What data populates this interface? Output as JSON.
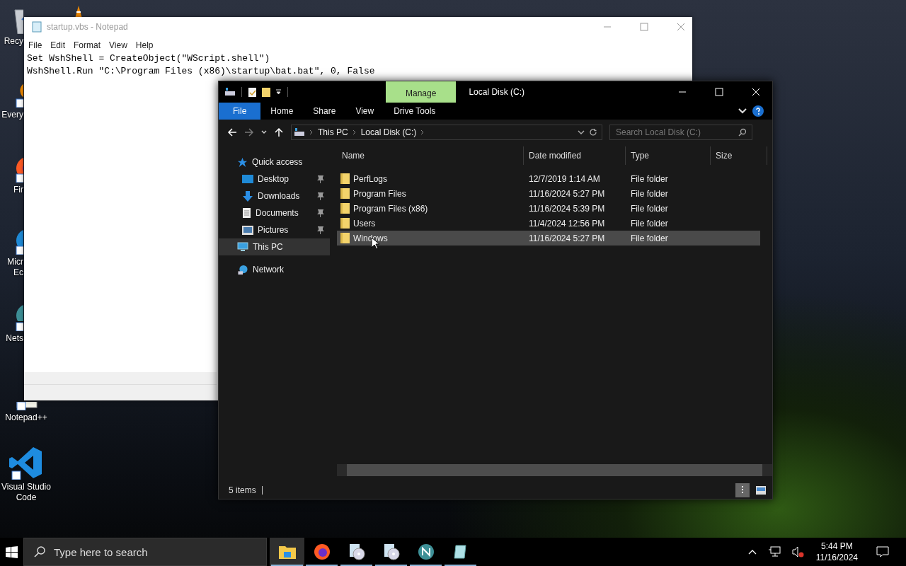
{
  "desktop_icons": [
    {
      "kind": "recycle-bin",
      "lines": [
        "Recy"
      ]
    },
    {
      "kind": "everything",
      "lines": [
        "Every"
      ]
    },
    {
      "kind": "firefox",
      "lines": [
        "Fir"
      ]
    },
    {
      "kind": "edge",
      "lines": [
        "Micr",
        "Ec"
      ]
    },
    {
      "kind": "netscape",
      "lines": [
        "Nets"
      ]
    },
    {
      "kind": "notepadpp",
      "lines": [
        "Notepad++"
      ]
    },
    {
      "kind": "vscode",
      "lines": [
        "Visual Studio",
        "Code"
      ]
    }
  ],
  "notepad": {
    "title": "startup.vbs - Notepad",
    "menu": [
      "File",
      "Edit",
      "Format",
      "View",
      "Help"
    ],
    "lines": [
      "Set WshShell = CreateObject(\"WScript.shell\")",
      "WshShell.Run \"C:\\Program Files (x86)\\startup\\bat.bat\", 0, False"
    ]
  },
  "explorer": {
    "context_tab": "Manage",
    "title": "Local Disk (C:)",
    "ribbon_tabs": [
      {
        "label": "File",
        "kind": "file"
      },
      {
        "label": "Home",
        "kind": "tab"
      },
      {
        "label": "Share",
        "kind": "tab"
      },
      {
        "label": "View",
        "kind": "tab"
      },
      {
        "label": "Drive Tools",
        "kind": "tab"
      }
    ],
    "breadcrumb": [
      "This PC",
      "Local Disk (C:)"
    ],
    "search": {
      "placeholder": "Search Local Disk (C:)"
    },
    "nav": [
      {
        "label": "Quick access",
        "kind": "star",
        "selected": false,
        "children": [
          {
            "label": "Desktop",
            "kind": "desktop",
            "pinned": true,
            "selected": false
          },
          {
            "label": "Downloads",
            "kind": "downloads",
            "pinned": true,
            "selected": false
          },
          {
            "label": "Documents",
            "kind": "documents",
            "pinned": true,
            "selected": false
          },
          {
            "label": "Pictures",
            "kind": "pictures",
            "pinned": true,
            "selected": false
          }
        ]
      },
      {
        "label": "This PC",
        "kind": "pc",
        "selected": true
      },
      {
        "label": "Network",
        "kind": "network",
        "selected": false
      }
    ],
    "columns": [
      "Name",
      "Date modified",
      "Type",
      "Size"
    ],
    "rows": [
      {
        "name": "PerfLogs",
        "date": "12/7/2019 1:14 AM",
        "type": "File folder",
        "selected": false
      },
      {
        "name": "Program Files",
        "date": "11/16/2024 5:27 PM",
        "type": "File folder",
        "selected": false
      },
      {
        "name": "Program Files (x86)",
        "date": "11/16/2024 5:39 PM",
        "type": "File folder",
        "selected": false
      },
      {
        "name": "Users",
        "date": "11/4/2024 12:56 PM",
        "type": "File folder",
        "selected": false
      },
      {
        "name": "Windows",
        "date": "11/16/2024 5:27 PM",
        "type": "File folder",
        "selected": true
      }
    ],
    "status": "5 items"
  },
  "taskbar": {
    "search_placeholder": "Type here to search",
    "apps": [
      {
        "kind": "folder",
        "active": true,
        "running": true
      },
      {
        "kind": "firefox",
        "active": false,
        "running": true
      },
      {
        "kind": "cd",
        "active": false,
        "running": true
      },
      {
        "kind": "cd",
        "active": false,
        "running": true
      },
      {
        "kind": "netscape",
        "active": false,
        "running": true
      },
      {
        "kind": "notepad",
        "active": false,
        "running": true
      }
    ],
    "time": "5:44 PM",
    "date": "11/16/2024"
  }
}
